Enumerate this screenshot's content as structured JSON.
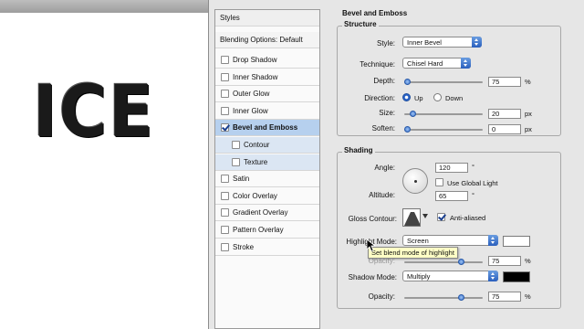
{
  "canvas": {
    "artwork_text": "ICE"
  },
  "styles_panel": {
    "header": "Styles",
    "blending_options": "Blending Options: Default",
    "items": [
      {
        "label": "Drop Shadow",
        "checked": false,
        "selected": false,
        "sub": false
      },
      {
        "label": "Inner Shadow",
        "checked": false,
        "selected": false,
        "sub": false
      },
      {
        "label": "Outer Glow",
        "checked": false,
        "selected": false,
        "sub": false
      },
      {
        "label": "Inner Glow",
        "checked": false,
        "selected": false,
        "sub": false
      },
      {
        "label": "Bevel and Emboss",
        "checked": true,
        "selected": true,
        "sub": false
      },
      {
        "label": "Contour",
        "checked": false,
        "selected": false,
        "sub": true
      },
      {
        "label": "Texture",
        "checked": false,
        "selected": false,
        "sub": true
      },
      {
        "label": "Satin",
        "checked": false,
        "selected": false,
        "sub": false
      },
      {
        "label": "Color Overlay",
        "checked": false,
        "selected": false,
        "sub": false
      },
      {
        "label": "Gradient Overlay",
        "checked": false,
        "selected": false,
        "sub": false
      },
      {
        "label": "Pattern Overlay",
        "checked": false,
        "selected": false,
        "sub": false
      },
      {
        "label": "Stroke",
        "checked": false,
        "selected": false,
        "sub": false
      }
    ]
  },
  "bevel": {
    "section_title": "Bevel and Emboss",
    "structure": {
      "title": "Structure",
      "style_label": "Style:",
      "style_value": "Inner Bevel",
      "technique_label": "Technique:",
      "technique_value": "Chisel Hard",
      "depth_label": "Depth:",
      "depth_value": "75",
      "depth_unit": "%",
      "depth_level": 0.0,
      "direction_label": "Direction:",
      "direction_up": "Up",
      "direction_down": "Down",
      "direction_selected": "Up",
      "size_label": "Size:",
      "size_value": "20",
      "size_unit": "px",
      "size_level": 0.08,
      "soften_label": "Soften:",
      "soften_value": "0",
      "soften_unit": "px",
      "soften_level": 0.0
    },
    "shading": {
      "title": "Shading",
      "angle_label": "Angle:",
      "angle_value": "120",
      "angle_unit": "°",
      "global_light_label": "Use Global Light",
      "global_light_checked": false,
      "altitude_label": "Altitude:",
      "altitude_value": "65",
      "altitude_unit": "°",
      "gloss_contour_label": "Gloss Contour:",
      "anti_aliased_label": "Anti-aliased",
      "anti_aliased_checked": true,
      "highlight_mode_label": "Highlight Mode:",
      "highlight_mode_value": "Screen",
      "highlight_color": "#ffffff",
      "highlight_opacity_value": "75",
      "highlight_opacity_unit": "%",
      "highlight_opacity_level": 0.75,
      "tooltip": "Set blend mode of highlight",
      "shadow_mode_label": "Shadow Mode:",
      "shadow_mode_value": "Multiply",
      "shadow_color": "#000000",
      "opacity_label": "Opacity:",
      "opacity_value": "75",
      "opacity_unit": "%",
      "opacity_level": 0.75
    }
  },
  "colors": {
    "selection": "#b6d0ee",
    "accent": "#2a5fbd"
  }
}
